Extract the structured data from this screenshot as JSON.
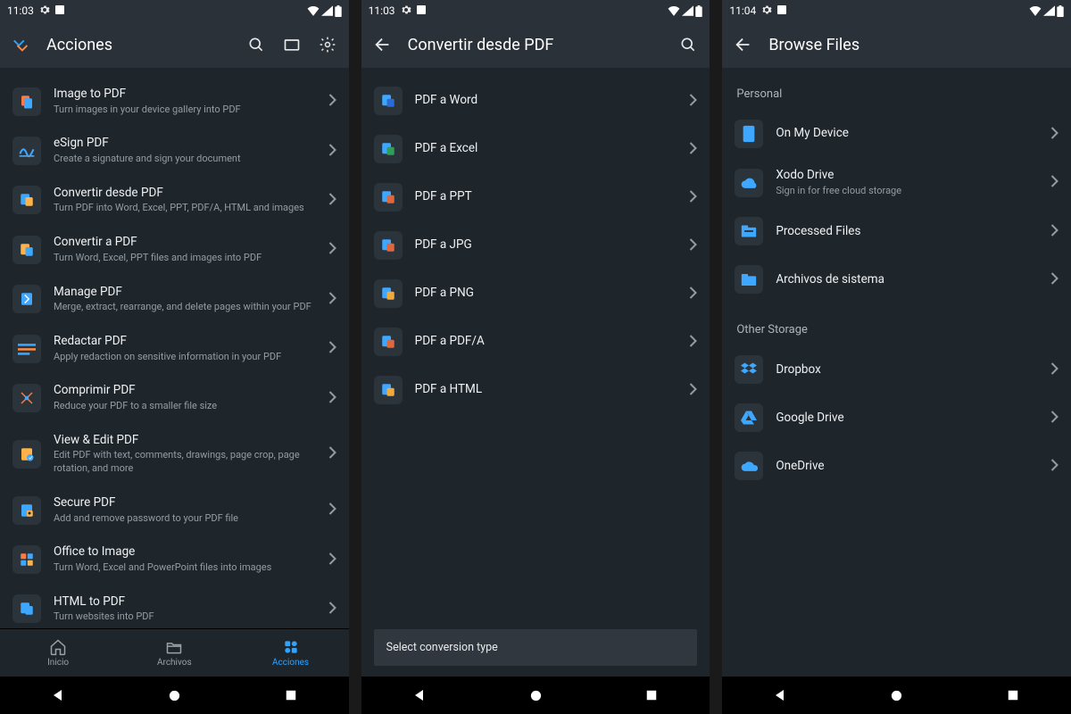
{
  "screen1": {
    "status_time": "11:03",
    "title": "Acciones",
    "items": [
      {
        "label": "Image to PDF",
        "sub": "Turn images in your device gallery into PDF"
      },
      {
        "label": "eSign PDF",
        "sub": "Create a signature and sign your document"
      },
      {
        "label": "Convertir desde PDF",
        "sub": "Turn PDF into Word, Excel, PPT, PDF/A, HTML and images"
      },
      {
        "label": "Convertir a PDF",
        "sub": "Turn Word, Excel, PPT files and images into PDF"
      },
      {
        "label": "Manage PDF",
        "sub": "Merge, extract, rearrange, and delete pages within your PDF"
      },
      {
        "label": "Redactar PDF",
        "sub": "Apply redaction on sensitive information in your PDF"
      },
      {
        "label": "Comprimir PDF",
        "sub": "Reduce your PDF to a smaller file size"
      },
      {
        "label": "View & Edit PDF",
        "sub": "Edit PDF with text, comments, drawings, page crop, page rotation, and more"
      },
      {
        "label": "Secure PDF",
        "sub": "Add and remove password to your PDF file"
      },
      {
        "label": "Office to Image",
        "sub": "Turn Word, Excel and PowerPoint files into images"
      },
      {
        "label": "HTML to PDF",
        "sub": "Turn websites into PDF"
      }
    ],
    "nav": {
      "inicio": "Inicio",
      "archivos": "Archivos",
      "acciones": "Acciones"
    }
  },
  "screen2": {
    "status_time": "11:03",
    "title": "Convertir desde PDF",
    "items": [
      {
        "label": "PDF a Word"
      },
      {
        "label": "PDF a Excel"
      },
      {
        "label": "PDF a PPT"
      },
      {
        "label": "PDF a JPG"
      },
      {
        "label": "PDF a PNG"
      },
      {
        "label": "PDF a PDF/A"
      },
      {
        "label": "PDF a HTML"
      }
    ],
    "toast": "Select conversion type"
  },
  "screen3": {
    "status_time": "11:04",
    "title": "Browse Files",
    "section_personal": "Personal",
    "personal": [
      {
        "label": "On My Device"
      },
      {
        "label": "Xodo Drive",
        "sub": "Sign in for free cloud storage"
      },
      {
        "label": "Processed Files"
      },
      {
        "label": "Archivos de sistema"
      }
    ],
    "section_other": "Other Storage",
    "other": [
      {
        "label": "Dropbox"
      },
      {
        "label": "Google Drive"
      },
      {
        "label": "OneDrive"
      }
    ]
  }
}
